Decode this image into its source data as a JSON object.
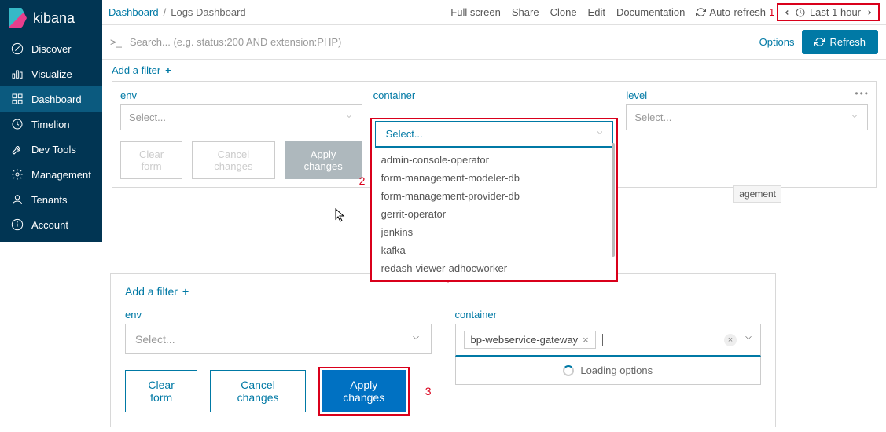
{
  "logo": "kibana",
  "nav": {
    "items": [
      {
        "label": "Discover"
      },
      {
        "label": "Visualize"
      },
      {
        "label": "Dashboard"
      },
      {
        "label": "Timelion"
      },
      {
        "label": "Dev Tools"
      },
      {
        "label": "Management"
      },
      {
        "label": "Tenants"
      },
      {
        "label": "Account"
      }
    ]
  },
  "breadcrumb": {
    "root": "Dashboard",
    "current": "Logs Dashboard"
  },
  "topbar": {
    "full_screen": "Full screen",
    "share": "Share",
    "clone": "Clone",
    "edit": "Edit",
    "documentation": "Documentation",
    "auto_refresh": "Auto-refresh",
    "time_label": "Last 1 hour"
  },
  "annotations": {
    "a1": "1",
    "a2": "2",
    "a3": "3"
  },
  "search": {
    "prefix": ">_",
    "placeholder": "Search... (e.g. status:200 AND extension:PHP)"
  },
  "options_link": "Options",
  "refresh_label": "Refresh",
  "add_filter": "Add a filter",
  "controls": {
    "env": {
      "label": "env",
      "placeholder": "Select..."
    },
    "container": {
      "label": "container",
      "placeholder": "Select..."
    },
    "level": {
      "label": "level",
      "placeholder": "Select..."
    }
  },
  "dropdown_items": [
    "admin-console-operator",
    "form-management-modeler-db",
    "form-management-provider-db",
    "gerrit-operator",
    "jenkins",
    "kafka",
    "redash-viewer-adhocworker"
  ],
  "buttons": {
    "clear": "Clear form",
    "cancel": "Cancel changes",
    "apply": "Apply changes"
  },
  "tag_management": "agement",
  "bottom": {
    "add_filter": "Add a filter",
    "env_label": "env",
    "env_placeholder": "Select...",
    "container_label": "container",
    "selected_chip": "bp-webservice-gateway",
    "loading": "Loading options",
    "clear": "Clear form",
    "cancel": "Cancel changes",
    "apply": "Apply changes"
  }
}
